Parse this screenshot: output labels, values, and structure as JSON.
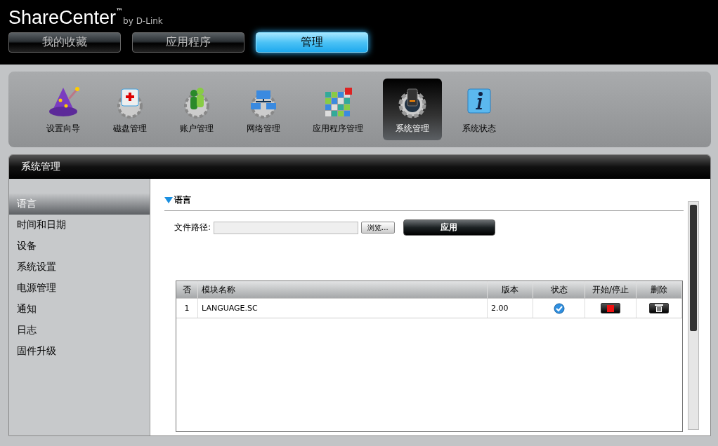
{
  "brand": {
    "name": "ShareCenter",
    "trademark": "™",
    "byline": "by D-Link"
  },
  "main_tabs": [
    {
      "label": "我的收藏",
      "selected": false
    },
    {
      "label": "应用程序",
      "selected": false
    },
    {
      "label": "管理",
      "selected": true
    }
  ],
  "toolbar": [
    {
      "kind": "wizard",
      "label": "设置向导",
      "selected": false
    },
    {
      "kind": "disk",
      "label": "磁盘管理",
      "selected": false
    },
    {
      "kind": "account",
      "label": "账户管理",
      "selected": false
    },
    {
      "kind": "network",
      "label": "网络管理",
      "selected": false
    },
    {
      "kind": "apps",
      "label": "应用程序管理",
      "selected": false
    },
    {
      "kind": "system",
      "label": "系统管理",
      "selected": true
    },
    {
      "kind": "info",
      "label": "系统状态",
      "selected": false
    }
  ],
  "panel_title": "系统管理",
  "sidebar": {
    "items": [
      {
        "label": "语言",
        "selected": true
      },
      {
        "label": "时间和日期",
        "selected": false
      },
      {
        "label": "设备",
        "selected": false
      },
      {
        "label": "系统设置",
        "selected": false
      },
      {
        "label": "电源管理",
        "selected": false
      },
      {
        "label": "通知",
        "selected": false
      },
      {
        "label": "日志",
        "selected": false
      },
      {
        "label": "固件升级",
        "selected": false
      }
    ]
  },
  "section": {
    "title": "语言",
    "expanded": true,
    "file_label": "文件路径:",
    "browse_button": "浏览...",
    "apply_button": "应用"
  },
  "table": {
    "columns": [
      "否",
      "模块名称",
      "版本",
      "状态",
      "开始/停止",
      "删除"
    ],
    "rows": [
      {
        "number": "1",
        "name": "LANGUAGE.SC",
        "version": "2.00",
        "enabled": true,
        "running": true
      }
    ]
  }
}
